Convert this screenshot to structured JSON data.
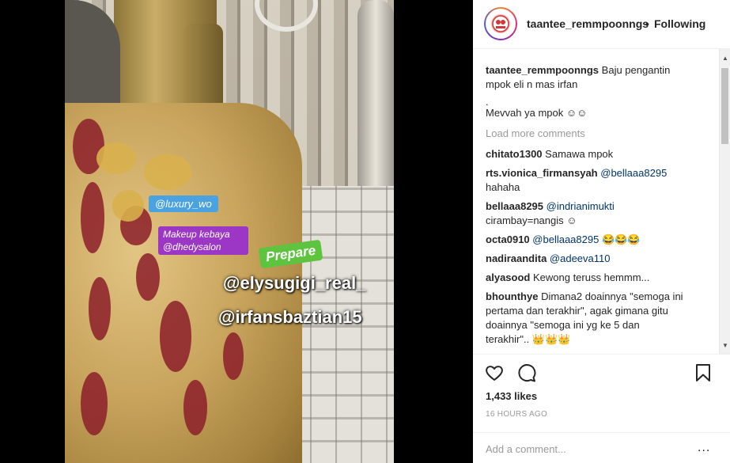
{
  "photo": {
    "stickers": {
      "luxury": "@luxury_wo",
      "makeup_line1": "Makeup kebaya",
      "makeup_line2": "@dhedysalon",
      "prepare": "Prepare",
      "ely": "@elysugigi_real_",
      "irfan": "@irfansbaztian15"
    }
  },
  "header": {
    "username": "taantee_remmpoonngs",
    "separator": "•",
    "follow_label": "Following",
    "avatar_icon": "profile-avatar"
  },
  "caption": {
    "username": "taantee_remmpoonngs",
    "line1": "Baju pengantin",
    "line2": "mpok eli n mas irfan",
    "line3": ".",
    "line4": "Mevvah ya mpok ☺☺"
  },
  "load_more": "Load more comments",
  "comments": [
    {
      "user": "chitato1300",
      "mention": "",
      "text": "Samawa mpok"
    },
    {
      "user": "rts.vionica_firmansyah",
      "mention": "@bellaaa8295",
      "text": "hahaha"
    },
    {
      "user": "bellaaa8295",
      "mention": "@indrianimukti",
      "text": "cirambay=nangis ☺"
    },
    {
      "user": "octa0910",
      "mention": "@bellaaa8295",
      "text": "😂😂😂"
    },
    {
      "user": "nadiraandita",
      "mention": "@adeeva110",
      "text": ""
    },
    {
      "user": "alyasood",
      "mention": "",
      "text": "Kewong teruss hemmm..."
    },
    {
      "user": "bhounthye",
      "mention": "",
      "line1": "Dimana2 doainnya \"semoga ini",
      "line2": "pertama dan terakhir\", agak gimana gitu",
      "line3": "doainnya \"semoga ini yg ke 5 dan",
      "line4": "terakhir\".. 👑👑👑"
    }
  ],
  "actions": {
    "like_icon": "heart-icon",
    "comment_icon": "comment-icon",
    "save_icon": "bookmark-icon"
  },
  "likes": "1,433 likes",
  "timestamp": "16 HOURS AGO",
  "add_comment": {
    "placeholder": "Add a comment...",
    "more": "..."
  }
}
